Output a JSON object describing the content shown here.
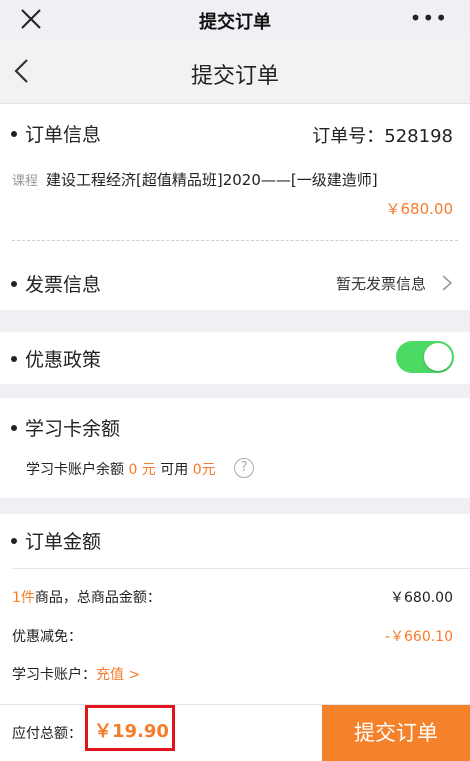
{
  "window": {
    "title": "提交订单",
    "more_label": "•••"
  },
  "nav": {
    "title": "提交订单"
  },
  "order_info": {
    "title": "订单信息",
    "order_number_label": "订单号：528198",
    "course_tag": "课程",
    "course_name": "建设工程经济[超值精品班]2020——[一级建造师]",
    "course_price": "￥680.00"
  },
  "invoice": {
    "title": "发票信息",
    "status": "暂无发票信息"
  },
  "discount": {
    "title": "优惠政策",
    "enabled": true,
    "toggle_color": "#4cd964"
  },
  "study_card": {
    "title": "学习卡余额",
    "balance_label": "学习卡账户余额",
    "balance_value": "0 元",
    "available_label": "可用",
    "available_value": "0元",
    "help_icon": "?"
  },
  "order_amount": {
    "title": "订单金额",
    "items_count": "1件",
    "items_label": "商品，总商品金额：",
    "items_total": "￥680.00",
    "discount_label": "优惠减免：",
    "discount_value": "-￥660.10",
    "card_account_label": "学习卡账户：",
    "recharge_label": "充值 >"
  },
  "footer": {
    "total_label": "应付总额：",
    "total_value": "￥19.90",
    "submit_label": "提交订单",
    "accent_color": "#f5812b",
    "highlight_color": "#e0161c"
  }
}
